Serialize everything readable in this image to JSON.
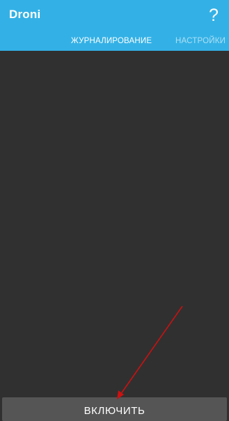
{
  "app": {
    "title": "Droni",
    "help_label": "?"
  },
  "tabs": [
    {
      "label": "ЖУРНАЛИРОВАНИЕ",
      "selected": true
    },
    {
      "label": "НАСТРОЙКИ",
      "selected": false
    }
  ],
  "main": {
    "enable_button_label": "ВКЛЮЧИТЬ"
  },
  "colors": {
    "appbar": "#33b1e6",
    "background": "#303030",
    "button": "#555555",
    "annotation_arrow": "#cc1111"
  },
  "annotation": {
    "icon": "red-arrow-pointing-to-enable-button"
  }
}
